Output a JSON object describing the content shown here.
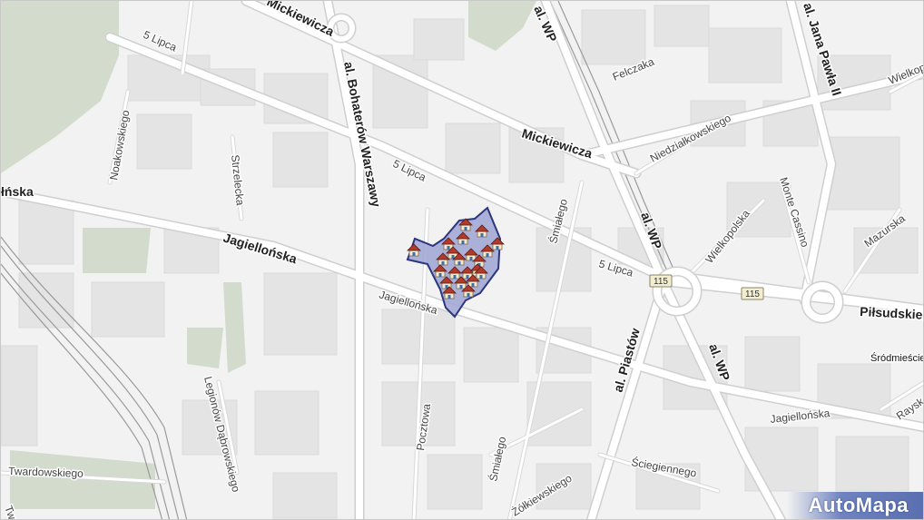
{
  "map": {
    "colors": {
      "background": "#f2f2f2",
      "block": "#e6e6e6",
      "green": "#d3dbcc",
      "road": "#ffffff",
      "road_outline": "#d2d2d2",
      "rail": "#9a9a9a",
      "highlight_fill": "#9ea5d3",
      "highlight_stroke": "#2c357f",
      "badge": "#f3eecf"
    },
    "streets": [
      {
        "id": "mickiewicza-top",
        "text": "Mickiewicza"
      },
      {
        "id": "5-lipca-nw",
        "text": "5 Lipca"
      },
      {
        "id": "al-bohaterow",
        "text": "al. Bohaterów Warszawy"
      },
      {
        "id": "al-wp-top",
        "text": "al. WP"
      },
      {
        "id": "felczaka",
        "text": "Felczaka"
      },
      {
        "id": "jana-pawla",
        "text": "al. Jana Pawła II"
      },
      {
        "id": "wielkopolska-top",
        "text": "Wielkop"
      },
      {
        "id": "noakowskiego",
        "text": "Noakowskiego"
      },
      {
        "id": "strzelecka",
        "text": "Strzelecka"
      },
      {
        "id": "mickiewicza-mid",
        "text": "Mickiewicza"
      },
      {
        "id": "niedzialkowskiego",
        "text": "Niedziałkowskiego"
      },
      {
        "id": "5-lipca-mid",
        "text": "5 Lipca"
      },
      {
        "id": "lnska",
        "text": "łńska"
      },
      {
        "id": "smialego-top",
        "text": "Śmiałego"
      },
      {
        "id": "al-wp-mid",
        "text": "al. WP"
      },
      {
        "id": "monte-cassino",
        "text": "Monte Cassino"
      },
      {
        "id": "wielkopolska",
        "text": "Wielkopolska"
      },
      {
        "id": "mazurska",
        "text": "Mazurska"
      },
      {
        "id": "jagiellonska-w",
        "text": "Jagiellońska"
      },
      {
        "id": "5-lipca-e",
        "text": "5 Lipca"
      },
      {
        "id": "jagiellonska-mid",
        "text": "Jagiellońska"
      },
      {
        "id": "pilsudskiego",
        "text": "Piłsudskiego"
      },
      {
        "id": "al-wp-low",
        "text": "al. WP"
      },
      {
        "id": "al-piastow",
        "text": "al. Piastów"
      },
      {
        "id": "legionow",
        "text": "Legionów Dąbrowskiego"
      },
      {
        "id": "pocztowa",
        "text": "Pocztowa"
      },
      {
        "id": "jagiellonska-e",
        "text": "Jagiellońska"
      },
      {
        "id": "rayski",
        "text": "Raysk"
      },
      {
        "id": "twardowskiego",
        "text": "Twardowskiego"
      },
      {
        "id": "smialego-low",
        "text": "Śmiałego"
      },
      {
        "id": "sciegiennego",
        "text": "Ściegiennego"
      },
      {
        "id": "zolkiewskiego",
        "text": "Żółkiewskiego"
      },
      {
        "id": "tw",
        "text": "Tw"
      }
    ],
    "districts": [
      {
        "id": "srodmiescie",
        "text": "Śródmieście"
      }
    ],
    "road_badges": [
      {
        "id": "badge-115-a",
        "text": "115"
      },
      {
        "id": "badge-115-b",
        "text": "115"
      }
    ],
    "highlight_area": {
      "marker_icon": "house-icon",
      "marker_count": 22
    },
    "branding": {
      "logo_text": "AutoMapa"
    }
  }
}
